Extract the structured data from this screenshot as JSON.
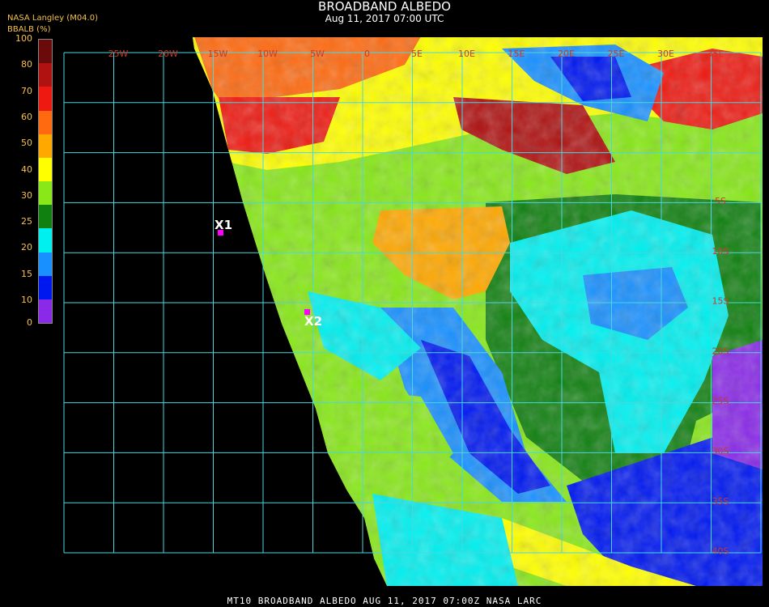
{
  "header": {
    "title": "BROADBAND ALBEDO",
    "subtitle": "Aug 11, 2017 07:00 UTC",
    "producer": "NASA Langley (M04.0)",
    "unit_label": "BBALB (%)"
  },
  "colorbar": {
    "ticks": [
      "100",
      "80",
      "70",
      "60",
      "50",
      "40",
      "30",
      "25",
      "20",
      "15",
      "10",
      "0"
    ],
    "colors": [
      "#6a0a0a",
      "#b01212",
      "#ee1a12",
      "#ff6a10",
      "#ffa800",
      "#ffff00",
      "#88e818",
      "#108010",
      "#00f0f0",
      "#1890ff",
      "#0018f0",
      "#8a2ae8"
    ]
  },
  "grid": {
    "line_color": "#47d8e0",
    "label_color": "#c83a2a",
    "lon_labels": [
      "25W",
      "20W",
      "15W",
      "10W",
      "5W",
      "0",
      "5E",
      "10E",
      "15E",
      "20E",
      "25E",
      "30E",
      "35E"
    ],
    "lat_labels": [
      "5S",
      "10S",
      "15S",
      "20S",
      "25S",
      "30S",
      "35S",
      "40S"
    ]
  },
  "markers": [
    {
      "label": "X1",
      "color": "#ff00ff"
    },
    {
      "label": "X2",
      "color": "#ff00ff"
    }
  ],
  "footer": {
    "text": "MT10  BROADBAND ALBEDO   AUG 11, 2017 07:00Z   NASA LARC"
  }
}
